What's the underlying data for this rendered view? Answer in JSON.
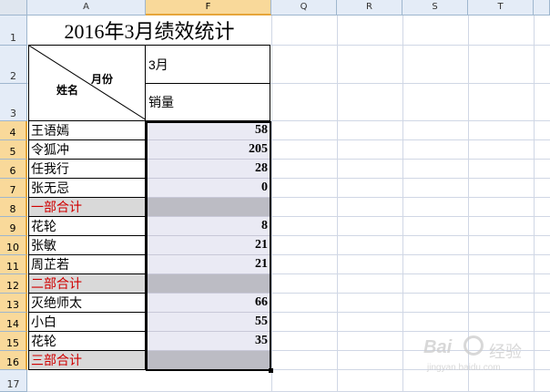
{
  "columns": {
    "A": "A",
    "F": "F",
    "Q": "Q",
    "R": "R",
    "S": "S",
    "T": "T"
  },
  "rows": [
    "1",
    "2",
    "3",
    "4",
    "5",
    "6",
    "7",
    "8",
    "9",
    "10",
    "11",
    "12",
    "13",
    "14",
    "15",
    "16",
    "17"
  ],
  "title": "2016年3月绩效统计",
  "header": {
    "month_label": "月份",
    "name_label": "姓名",
    "month_value": "3月",
    "sales_label": "销量"
  },
  "data_rows": [
    {
      "name": "王语嫣",
      "value": "58",
      "subtotal": false
    },
    {
      "name": "令狐冲",
      "value": "205",
      "subtotal": false
    },
    {
      "name": "任我行",
      "value": "28",
      "subtotal": false
    },
    {
      "name": "张无忌",
      "value": "0",
      "subtotal": false
    },
    {
      "name": "一部合计",
      "value": "",
      "subtotal": true
    },
    {
      "name": "花轮",
      "value": "8",
      "subtotal": false
    },
    {
      "name": "张敏",
      "value": "21",
      "subtotal": false
    },
    {
      "name": "周芷若",
      "value": "21",
      "subtotal": false
    },
    {
      "name": "二部合计",
      "value": "",
      "subtotal": true
    },
    {
      "name": "灭绝师太",
      "value": "66",
      "subtotal": false
    },
    {
      "name": "小白",
      "value": "55",
      "subtotal": false
    },
    {
      "name": "花轮",
      "value": "35",
      "subtotal": false
    },
    {
      "name": "三部合计",
      "value": "",
      "subtotal": true
    }
  ],
  "watermark": {
    "brand": "Bai",
    "brand2": "经验",
    "url": "jingyan.baidu.com"
  },
  "colors": {
    "subtotal_text": "#d00000",
    "selection_header": "#f9d99a"
  }
}
